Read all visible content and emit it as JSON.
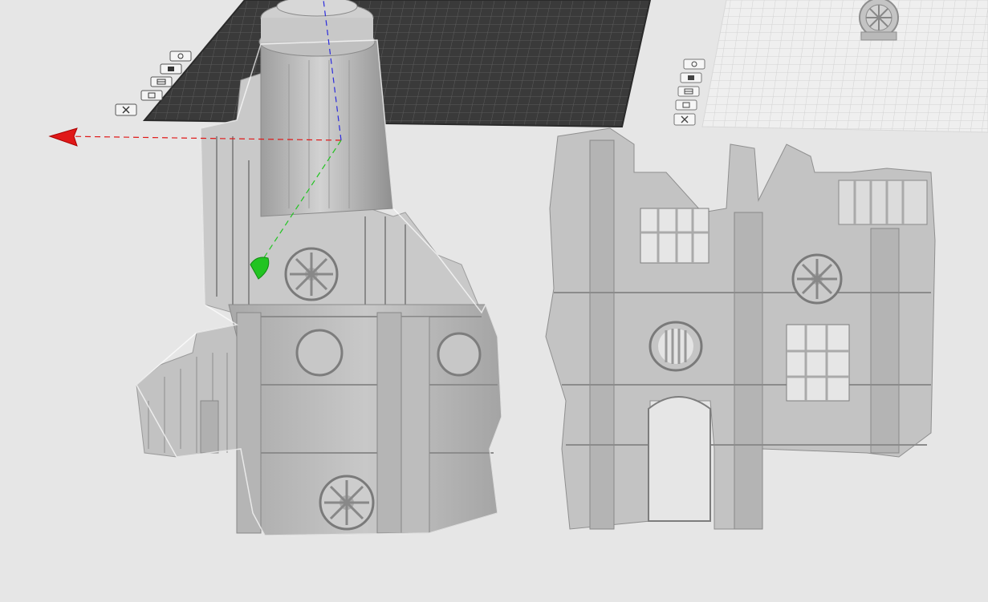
{
  "app": "slicer-3d-viewport",
  "scene": {
    "background": "#e6e6e6",
    "active_plate": {
      "label": "",
      "plate_color": "#3a3a3a",
      "grid_color": "#5a5a5a",
      "icons": [
        "orient-icon",
        "arrange-icon",
        "auto-layout-icon",
        "plate-settings-icon",
        "delete-plate-icon"
      ]
    },
    "inactive_plate": {
      "plate_color": "#ededed",
      "grid_color": "#d0d0d0",
      "icons": [
        "orient-icon",
        "arrange-icon",
        "auto-layout-icon",
        "plate-settings-icon",
        "delete-plate-icon"
      ]
    },
    "gizmo": {
      "x_axis_color": "#e01818",
      "y_axis_color": "#22c422",
      "z_axis_color": "#2b2bdd"
    },
    "models": [
      {
        "name": "ruined-tower-wall",
        "selected": true,
        "color": "#bdbdbd"
      },
      {
        "name": "ruined-building-wall",
        "selected": false,
        "color": "#bdbdbd"
      },
      {
        "name": "fan-part",
        "selected": false,
        "color": "#bdbdbd"
      }
    ]
  }
}
